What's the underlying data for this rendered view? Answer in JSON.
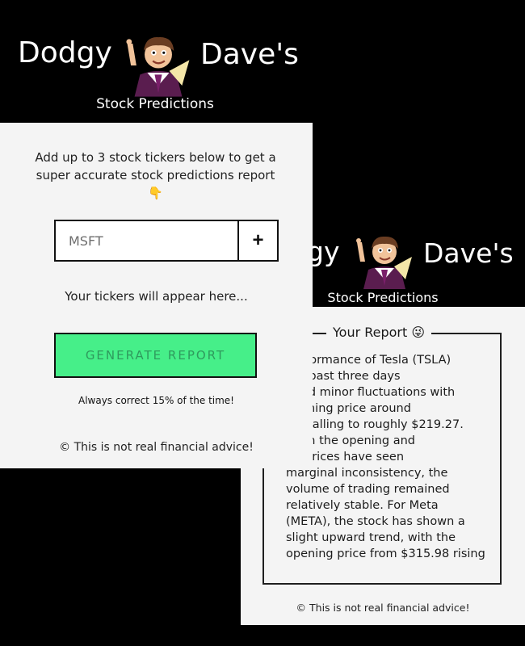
{
  "brand": {
    "word1": "Dodgy",
    "word2": "Dave's",
    "subtitle": "Stock Predictions"
  },
  "back_brand": {
    "word1": "gy",
    "word2": "Dave's",
    "subtitle": "Stock Predictions"
  },
  "input_panel": {
    "intro": "Add up to 3 stock tickers below to get a super accurate stock predictions report👇",
    "ticker_placeholder": "MSFT",
    "add_button_label": "+",
    "tickers_placeholder_text": "Your tickers will appear here...",
    "generate_button_label": "GENERATE REPORT",
    "tagline": "Always correct 15% of the time!",
    "footer": "© This is not real financial advice!"
  },
  "report_panel": {
    "heading": "Your Report 😜",
    "body": "performance of Tesla (TSLA)\nthe past three days\npited minor fluctuations with\nopening price around\n.98 falling to roughly $219.27.\nough the opening and\nng prices have seen\nmarginal inconsistency, the\nvolume of trading remained\nrelatively stable. For Meta\n(META), the stock has shown a\nslight upward trend, with the\nopening price from $315.98 rising",
    "footer": "© This is not real financial advice!"
  },
  "colors": {
    "background": "#000000",
    "card": "#f4f4f4",
    "generate_button": "#46ef89"
  },
  "icons": {
    "mascot": "cartoon-salesman-mascot"
  }
}
